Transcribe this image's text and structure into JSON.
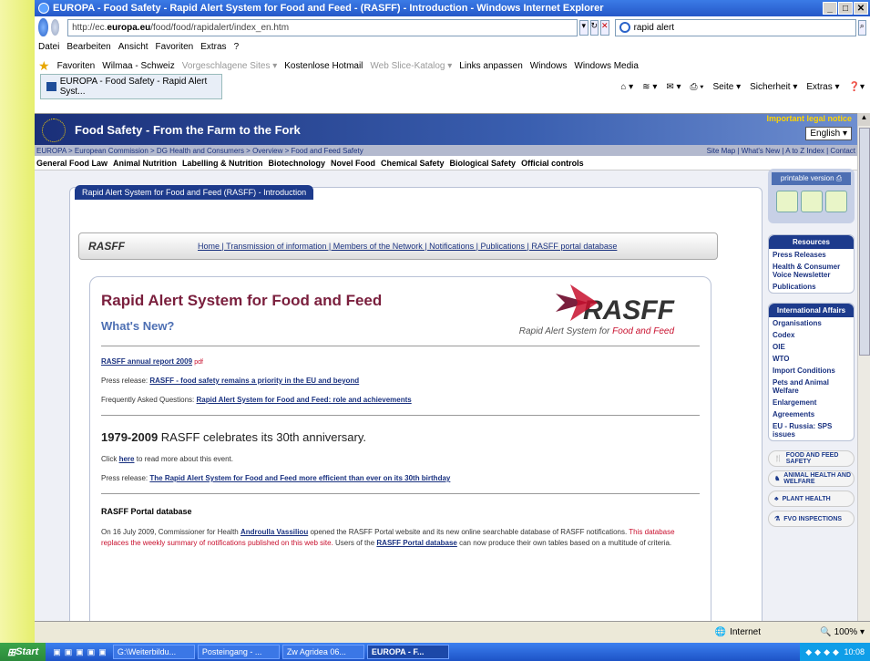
{
  "window": {
    "title": "EUROPA - Food Safety - Rapid Alert System for Food and Feed - (RASFF) - Introduction - Windows Internet Explorer"
  },
  "address": {
    "url_pre": "http://ec.",
    "url_host": "europa.eu",
    "url_post": "/food/food/rapidalert/index_en.htm",
    "search_value": "rapid alert"
  },
  "menu": [
    "Datei",
    "Bearbeiten",
    "Ansicht",
    "Favoriten",
    "Extras",
    "?"
  ],
  "favorites": {
    "label": "Favoriten",
    "items": [
      "Wilmaa - Schweiz",
      "Vorgeschlagene Sites ▾",
      "Kostenlose Hotmail",
      "Web Slice-Katalog ▾",
      "Links anpassen",
      "Windows",
      "Windows Media"
    ]
  },
  "tab": {
    "label": "EUROPA - Food Safety - Rapid Alert Syst..."
  },
  "commands": [
    "Seite ▾",
    "Sicherheit ▾",
    "Extras ▾"
  ],
  "banner": {
    "title": "Food Safety - From the Farm to the Fork",
    "legal": "Important legal notice",
    "language": "English"
  },
  "breadcrumb": {
    "left": "EUROPA > European Commission > DG Health and Consumers > Overview > Food and Feed Safety",
    "right": "Site Map | What's New | A to Z Index | Contact"
  },
  "topics": [
    "General Food Law",
    "Animal Nutrition",
    "Labelling & Nutrition",
    "Biotechnology",
    "Novel Food",
    "Chemical Safety",
    "Biological Safety",
    "Official controls"
  ],
  "page": {
    "tab_title": "Rapid Alert System for Food and Feed (RASFF) - Introduction",
    "subnav_logo": "RASFF",
    "subnav_links": "Home | Transmission of information | Members of the Network | Notifications | Publications | RASFF portal database",
    "heading": "Rapid Alert System for Food and Feed",
    "whats_new": "What's New?",
    "logo_word": "RASFF",
    "logo_sub_a": "Rapid Alert System for",
    "logo_sub_b": "Food and Feed",
    "annual_report": "RASFF annual report 2009",
    "pdf_tag": "pdf",
    "press1_prefix": "Press release:",
    "press1_link": "RASFF - food safety remains a priority in the EU and beyond",
    "faq_prefix": "Frequently Asked Questions:",
    "faq_link": "Rapid Alert System for Food and Feed: role and achievements",
    "anniv_year": "1979-2009",
    "anniv_text": "RASFF celebrates its 30th anniversary.",
    "click_pre": "Click",
    "click_link": "here",
    "click_post": "to read more about this event.",
    "press2_prefix": "Press release:",
    "press2_link": "The Rapid Alert System for Food and Feed more efficient than ever on its 30th birthday",
    "portal_heading": "RASFF Portal database",
    "portal_text_1": "On 16 July 2009, Commissioner for Health",
    "portal_name": "Androulla Vassiliou",
    "portal_text_2": "opened the RASFF Portal website and its new online searchable database of RASFF notifications.",
    "portal_red": "This database replaces the weekly summary of notifications published on this web site.",
    "portal_text_3": "Users of the",
    "portal_link": "RASFF Portal database",
    "portal_text_4": "can now produce their own tables based on a multitude of criteria."
  },
  "sidebar": {
    "printable": "printable version",
    "resources": {
      "title": "Resources",
      "items": [
        "Press Releases",
        "Health & Consumer Voice Newsletter",
        "Publications"
      ]
    },
    "international": {
      "title": "International Affairs",
      "items": [
        "Organisations",
        "Codex",
        "OIE",
        "WTO",
        "Import Conditions",
        "Pets and Animal Welfare",
        "Enlargement",
        "Agreements",
        "EU - Russia: SPS issues"
      ]
    },
    "pills": [
      "FOOD AND FEED SAFETY",
      "ANIMAL HEALTH AND WELFARE",
      "PLANT HEALTH",
      "FVO INSPECTIONS"
    ]
  },
  "status": {
    "zone": "Internet",
    "zoom": "100%"
  },
  "taskbar": {
    "start": "Start",
    "items": [
      "G:\\Weiterbildu...",
      "Posteingang - ...",
      "Zw Agridea 06...",
      "EUROPA - F..."
    ],
    "clock": "10:08"
  },
  "colors": {
    "brand": "#1d3b8c",
    "accent_red": "#c8102e",
    "heading": "#7a1f3d"
  }
}
